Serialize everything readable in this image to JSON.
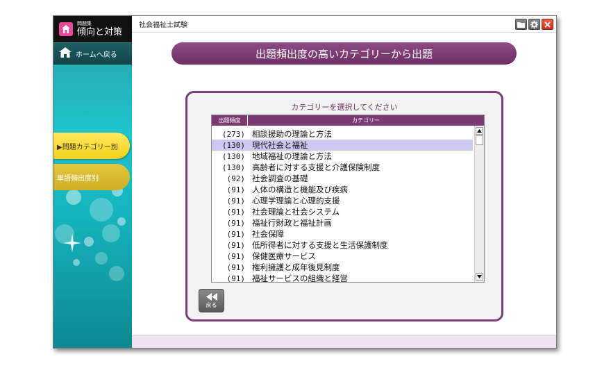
{
  "app": {
    "brand_sub": "問題集",
    "brand_main": "傾向と対策",
    "window_title": "社会福祉士試験"
  },
  "sidebar": {
    "home_label": "ホームへ戻る",
    "tabs": [
      {
        "label": "▶問題カテゴリー別",
        "active": true
      },
      {
        "label": "単語頻出度別",
        "active": false
      }
    ]
  },
  "header": {
    "title": "出題頻出度の高いカテゴリーから出題"
  },
  "panel": {
    "title": "カテゴリーを選択してください",
    "col_count": "出題頻度",
    "col_category": "カテゴリー",
    "rows": [
      {
        "count": "(273)",
        "category": "相談援助の理論と方法"
      },
      {
        "count": "(130)",
        "category": "現代社会と福祉",
        "selected": true
      },
      {
        "count": "(130)",
        "category": "地域福祉の理論と方法"
      },
      {
        "count": "(130)",
        "category": "高齢者に対する支援と介護保険制度"
      },
      {
        "count": "(92)",
        "category": "社会調査の基礎"
      },
      {
        "count": "(91)",
        "category": "人体の構造と機能及び疾病"
      },
      {
        "count": "(91)",
        "category": "心理学理論と心理的支援"
      },
      {
        "count": "(91)",
        "category": "社会理論と社会システム"
      },
      {
        "count": "(91)",
        "category": "福祉行財政と福祉計画"
      },
      {
        "count": "(91)",
        "category": "社会保障"
      },
      {
        "count": "(91)",
        "category": "低所得者に対する支援と生活保護制度"
      },
      {
        "count": "(91)",
        "category": "保健医療サービス"
      },
      {
        "count": "(91)",
        "category": "権利擁護と成年後見制度"
      },
      {
        "count": "(91)",
        "category": "福祉サービスの組織と経営"
      }
    ],
    "back_label": "戻る"
  },
  "icons": {
    "brand": "house-icon",
    "home": "home-icon",
    "folder": "folder-icon",
    "settings": "gear-icon",
    "close": "close-icon",
    "back": "rewind-icon"
  },
  "colors": {
    "accent": "#7b3a72",
    "selected_row": "#c9c9f2",
    "tab_active": "#f4cf1c",
    "sidebar": "#1ec3cc"
  }
}
